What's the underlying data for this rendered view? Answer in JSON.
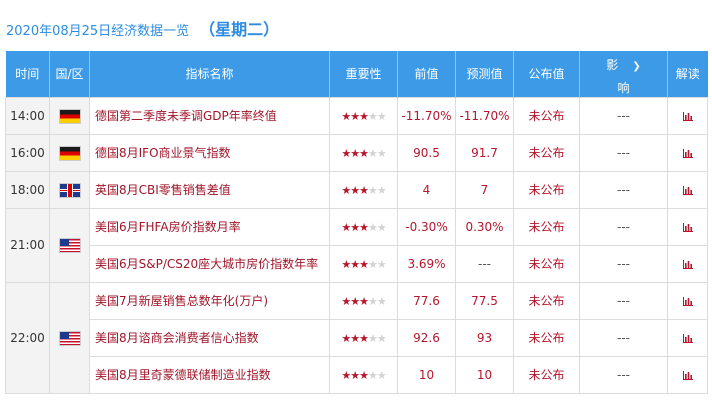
{
  "header": {
    "date_title": "2020年08月25日经济数据一览",
    "weekday": "（星期二）"
  },
  "columns": {
    "time": "时间",
    "region": "国/区",
    "indicator": "指标名称",
    "importance": "重要性",
    "previous": "前值",
    "forecast": "预测值",
    "actual": "公布值",
    "influence_1": "影",
    "influence_2": "响",
    "interpret": "解读"
  },
  "rows": [
    {
      "time": "14:00",
      "country": "Germany",
      "flag_icon": "germany-flag-icon",
      "indicator": "德国第二季度未季调GDP年率终值",
      "stars": 3,
      "previous": "-11.70%",
      "forecast": "-11.70%",
      "actual": "未公布",
      "influence": "---"
    },
    {
      "time": "16:00",
      "country": "Germany",
      "flag_icon": "germany-flag-icon",
      "indicator": "德国8月IFO商业景气指数",
      "stars": 3,
      "previous": "90.5",
      "forecast": "91.7",
      "actual": "未公布",
      "influence": "---"
    },
    {
      "time": "18:00",
      "country": "UK",
      "flag_icon": "uk-flag-icon",
      "indicator": "英国8月CBI零售销售差值",
      "stars": 3,
      "previous": "4",
      "forecast": "7",
      "actual": "未公布",
      "influence": "---"
    },
    {
      "time": "21:00",
      "country": "US",
      "flag_icon": "us-flag-icon",
      "indicator": "美国6月FHFA房价指数月率",
      "stars": 3,
      "previous": "-0.30%",
      "forecast": "0.30%",
      "actual": "未公布",
      "influence": "---"
    },
    {
      "time": "",
      "country": "US",
      "flag_icon": "",
      "indicator": "美国6月S&P/CS20座大城市房价指数年率",
      "stars": 3,
      "previous": "3.69%",
      "forecast": "---",
      "actual": "未公布",
      "influence": "---"
    },
    {
      "time": "22:00",
      "country": "US",
      "flag_icon": "us-flag-icon",
      "indicator": "美国7月新屋销售总数年化(万户)",
      "stars": 3,
      "previous": "77.6",
      "forecast": "77.5",
      "actual": "未公布",
      "influence": "---"
    },
    {
      "time": "",
      "country": "US",
      "flag_icon": "",
      "indicator": "美国8月谘商会消费者信心指数",
      "stars": 3,
      "previous": "92.6",
      "forecast": "93",
      "actual": "未公布",
      "influence": "---"
    },
    {
      "time": "",
      "country": "US",
      "flag_icon": "",
      "indicator": "美国8月里奇蒙德联储制造业指数",
      "stars": 3,
      "previous": "10",
      "forecast": "10",
      "actual": "未公布",
      "influence": "---"
    }
  ],
  "colors": {
    "header_bg": "#3d9ae6",
    "title_blue": "#2d8ce0",
    "value_red": "#b5162d"
  },
  "icons": {
    "interpret": "bar-chart-icon",
    "influence_dropdown": "chevron-down-icon"
  }
}
